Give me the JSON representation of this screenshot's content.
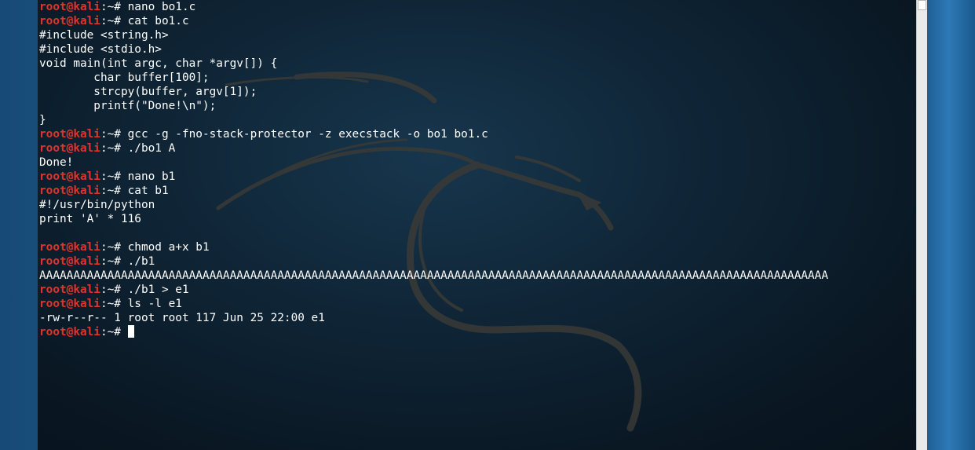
{
  "terminal": {
    "prompt": {
      "user_host": "root@kali",
      "separator": ":",
      "path": "~",
      "symbol": "# "
    },
    "lines": [
      {
        "type": "cmd",
        "text": "nano bo1.c"
      },
      {
        "type": "cmd",
        "text": "cat bo1.c"
      },
      {
        "type": "out",
        "text": "#include <string.h>"
      },
      {
        "type": "out",
        "text": "#include <stdio.h>"
      },
      {
        "type": "out",
        "text": "void main(int argc, char *argv[]) {"
      },
      {
        "type": "out",
        "text": "        char buffer[100];"
      },
      {
        "type": "out",
        "text": "        strcpy(buffer, argv[1]);"
      },
      {
        "type": "out",
        "text": "        printf(\"Done!\\n\");"
      },
      {
        "type": "out",
        "text": "}"
      },
      {
        "type": "cmd",
        "text": "gcc -g -fno-stack-protector -z execstack -o bo1 bo1.c"
      },
      {
        "type": "cmd",
        "text": "./bo1 A"
      },
      {
        "type": "out",
        "text": "Done!"
      },
      {
        "type": "cmd",
        "text": "nano b1"
      },
      {
        "type": "cmd",
        "text": "cat b1"
      },
      {
        "type": "out",
        "text": "#!/usr/bin/python"
      },
      {
        "type": "out",
        "text": "print 'A' * 116"
      },
      {
        "type": "out",
        "text": ""
      },
      {
        "type": "cmd",
        "text": "chmod a+x b1"
      },
      {
        "type": "cmd",
        "text": "./b1"
      },
      {
        "type": "out",
        "text": "AAAAAAAAAAAAAAAAAAAAAAAAAAAAAAAAAAAAAAAAAAAAAAAAAAAAAAAAAAAAAAAAAAAAAAAAAAAAAAAAAAAAAAAAAAAAAAAAAAAAAAAAAAAAAAAAAAAA"
      },
      {
        "type": "cmd",
        "text": "./b1 > e1"
      },
      {
        "type": "cmd",
        "text": "ls -l e1"
      },
      {
        "type": "out",
        "text": "-rw-r--r-- 1 root root 117 Jun 25 22:00 e1"
      },
      {
        "type": "cursor",
        "text": ""
      }
    ]
  },
  "colors": {
    "prompt_user": "#e0342c",
    "text": "#ffffff",
    "terminal_bg": "#0f2536"
  },
  "icons": {
    "background_logo": "kali-dragon-logo"
  }
}
